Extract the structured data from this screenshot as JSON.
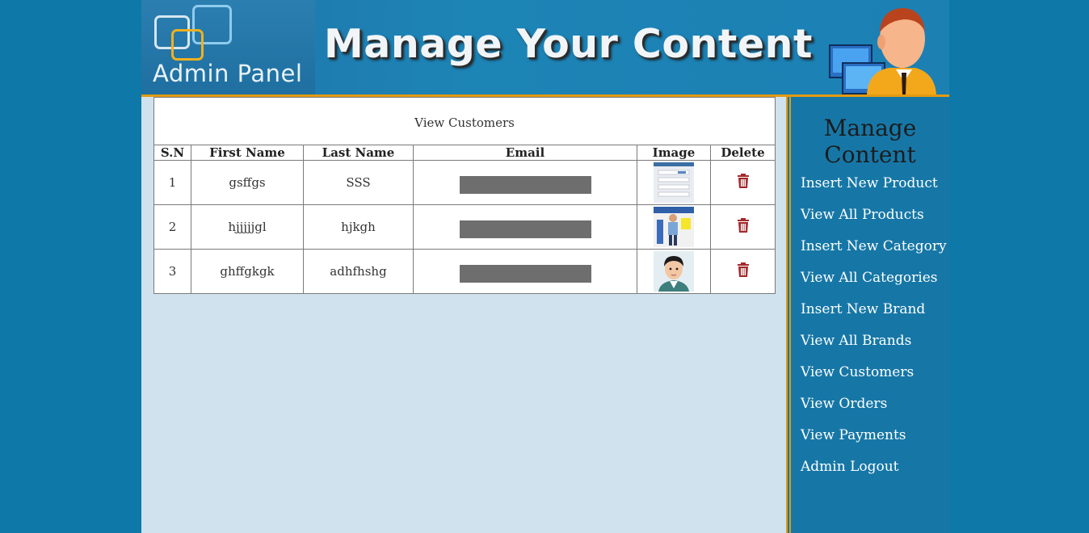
{
  "header": {
    "logo_text": "Admin Panel",
    "banner_title": "Manage Your Content"
  },
  "main": {
    "title": "View Customers",
    "columns": [
      "S.N",
      "First Name",
      "Last Name",
      "Email",
      "Image",
      "Delete"
    ],
    "rows": [
      {
        "sn": "1",
        "first_name": "gsffgs",
        "last_name": "SSS"
      },
      {
        "sn": "2",
        "first_name": "hjjjjjgl",
        "last_name": "hjkgh"
      },
      {
        "sn": "3",
        "first_name": "ghffgkgk",
        "last_name": "adhfhshg"
      }
    ]
  },
  "sidebar": {
    "title": "Manage Content",
    "items": [
      {
        "label": "Insert New Product"
      },
      {
        "label": "View All Products"
      },
      {
        "label": "Insert New Category"
      },
      {
        "label": "View All Categories"
      },
      {
        "label": "Insert New Brand"
      },
      {
        "label": "View All Brands"
      },
      {
        "label": "View Customers"
      },
      {
        "label": "View Orders"
      },
      {
        "label": "View Payments"
      },
      {
        "label": "Admin Logout"
      }
    ]
  },
  "icons": {
    "delete": "trash-icon"
  },
  "colors": {
    "page_bg": "#0e79a8",
    "accent": "#e39a12",
    "content_bg": "#cfe2ee",
    "sidebar_bg": "#1677a7",
    "trash": "#a3282b",
    "redaction": "#6e6e6e"
  }
}
